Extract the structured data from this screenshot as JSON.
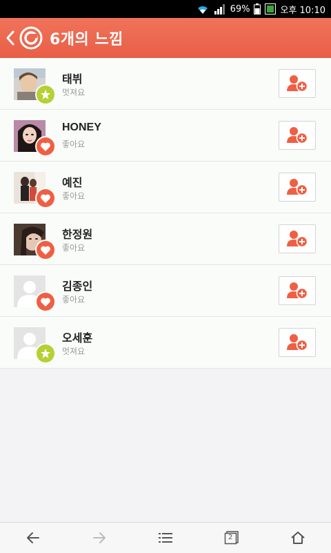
{
  "status_bar": {
    "battery": "69%",
    "time": "오후 10:10"
  },
  "header": {
    "title": "6개의 느낌",
    "accent_color": "#ec6a50"
  },
  "users": [
    {
      "name": "태뷔",
      "reaction": "멋져요",
      "badge": "star-icon"
    },
    {
      "name": "HONEY",
      "reaction": "좋아요",
      "badge": "heart-icon"
    },
    {
      "name": "예진",
      "reaction": "좋아요",
      "badge": "heart-icon"
    },
    {
      "name": "한정원",
      "reaction": "좋아요",
      "badge": "heart-icon"
    },
    {
      "name": "김종인",
      "reaction": "좋아요",
      "badge": "heart-icon"
    },
    {
      "name": "오세훈",
      "reaction": "멋져요",
      "badge": "star-icon"
    }
  ],
  "bottom_nav": {
    "tabs_count": "2"
  }
}
